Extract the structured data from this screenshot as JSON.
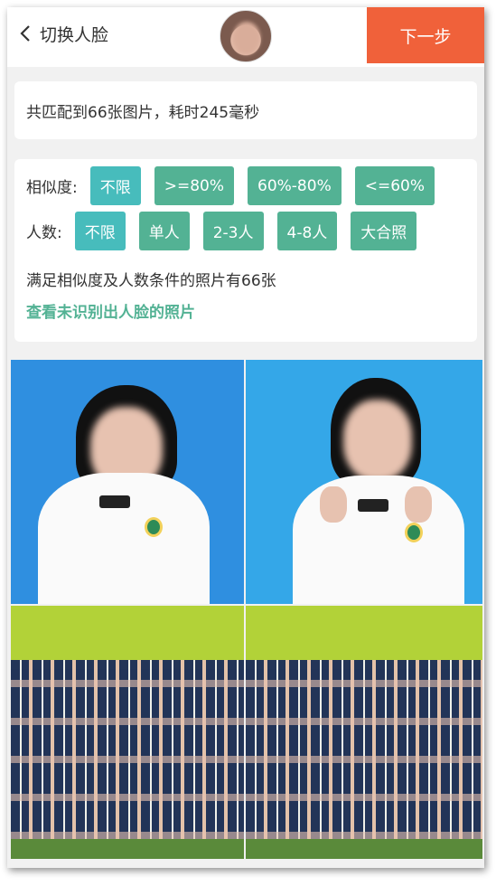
{
  "header": {
    "back_label": "切换人脸",
    "next_label": "下一步"
  },
  "stats": {
    "text": "共匹配到66张图片，耗时245毫秒"
  },
  "filters": {
    "similarity_label": "相似度:",
    "similarity_options": [
      "不限",
      ">=80%",
      "60%-80%",
      "<=60%"
    ],
    "similarity_selected": "不限",
    "people_label": "人数:",
    "people_options": [
      "不限",
      "单人",
      "2-3人",
      "4-8人",
      "大合照"
    ],
    "people_selected": "不限",
    "summary": "满足相似度及人数条件的照片有66张",
    "unrecognized_link": "查看未识别出人脸的照片"
  },
  "colors": {
    "accent_orange": "#f0613a",
    "chip_green": "#53b294",
    "chip_selected": "#47bcbc",
    "link_green": "#53b294"
  },
  "icons": {
    "back": "chevron-left-icon"
  }
}
